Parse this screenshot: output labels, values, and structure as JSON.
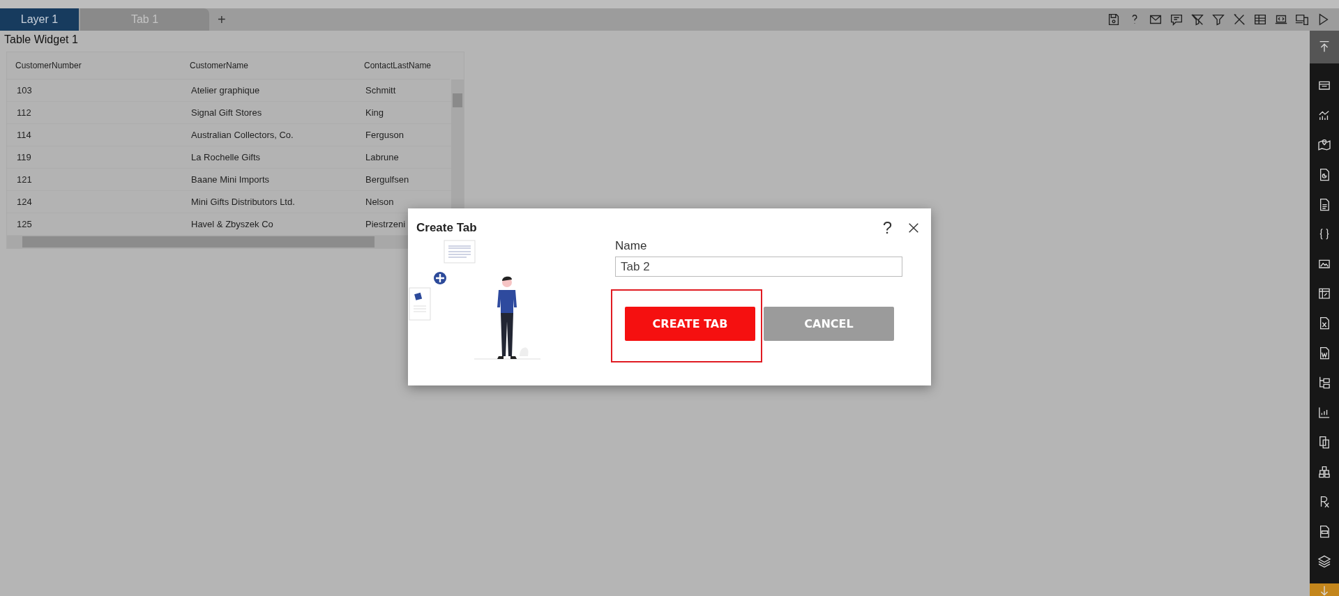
{
  "tabs": [
    {
      "label": "Layer 1",
      "selected": true
    },
    {
      "label": "Tab 1",
      "selected": false
    }
  ],
  "add_tab": "+",
  "widget": {
    "title": "Table Widget 1",
    "table": {
      "columns": [
        "CustomerNumber",
        "CustomerName",
        "ContactLastName"
      ],
      "rows": [
        [
          "103",
          "Atelier graphique",
          "Schmitt"
        ],
        [
          "112",
          "Signal Gift Stores",
          "King"
        ],
        [
          "114",
          "Australian Collectors, Co.",
          "Ferguson"
        ],
        [
          "119",
          "La Rochelle Gifts",
          "Labrune"
        ],
        [
          "121",
          "Baane Mini Imports",
          "Bergulfsen"
        ],
        [
          "124",
          "Mini Gifts Distributors Ltd.",
          "Nelson"
        ],
        [
          "125",
          "Havel & Zbyszek Co",
          "Piestrzeni"
        ]
      ]
    }
  },
  "dialog": {
    "title": "Create Tab",
    "help": "?",
    "name_label": "Name",
    "name_value": "Tab 2",
    "buttons": [
      {
        "label": "CREATE TAB",
        "kind": "primary",
        "highlighted": true
      },
      {
        "label": "CANCEL",
        "kind": "secondary",
        "highlighted": false
      }
    ]
  }
}
